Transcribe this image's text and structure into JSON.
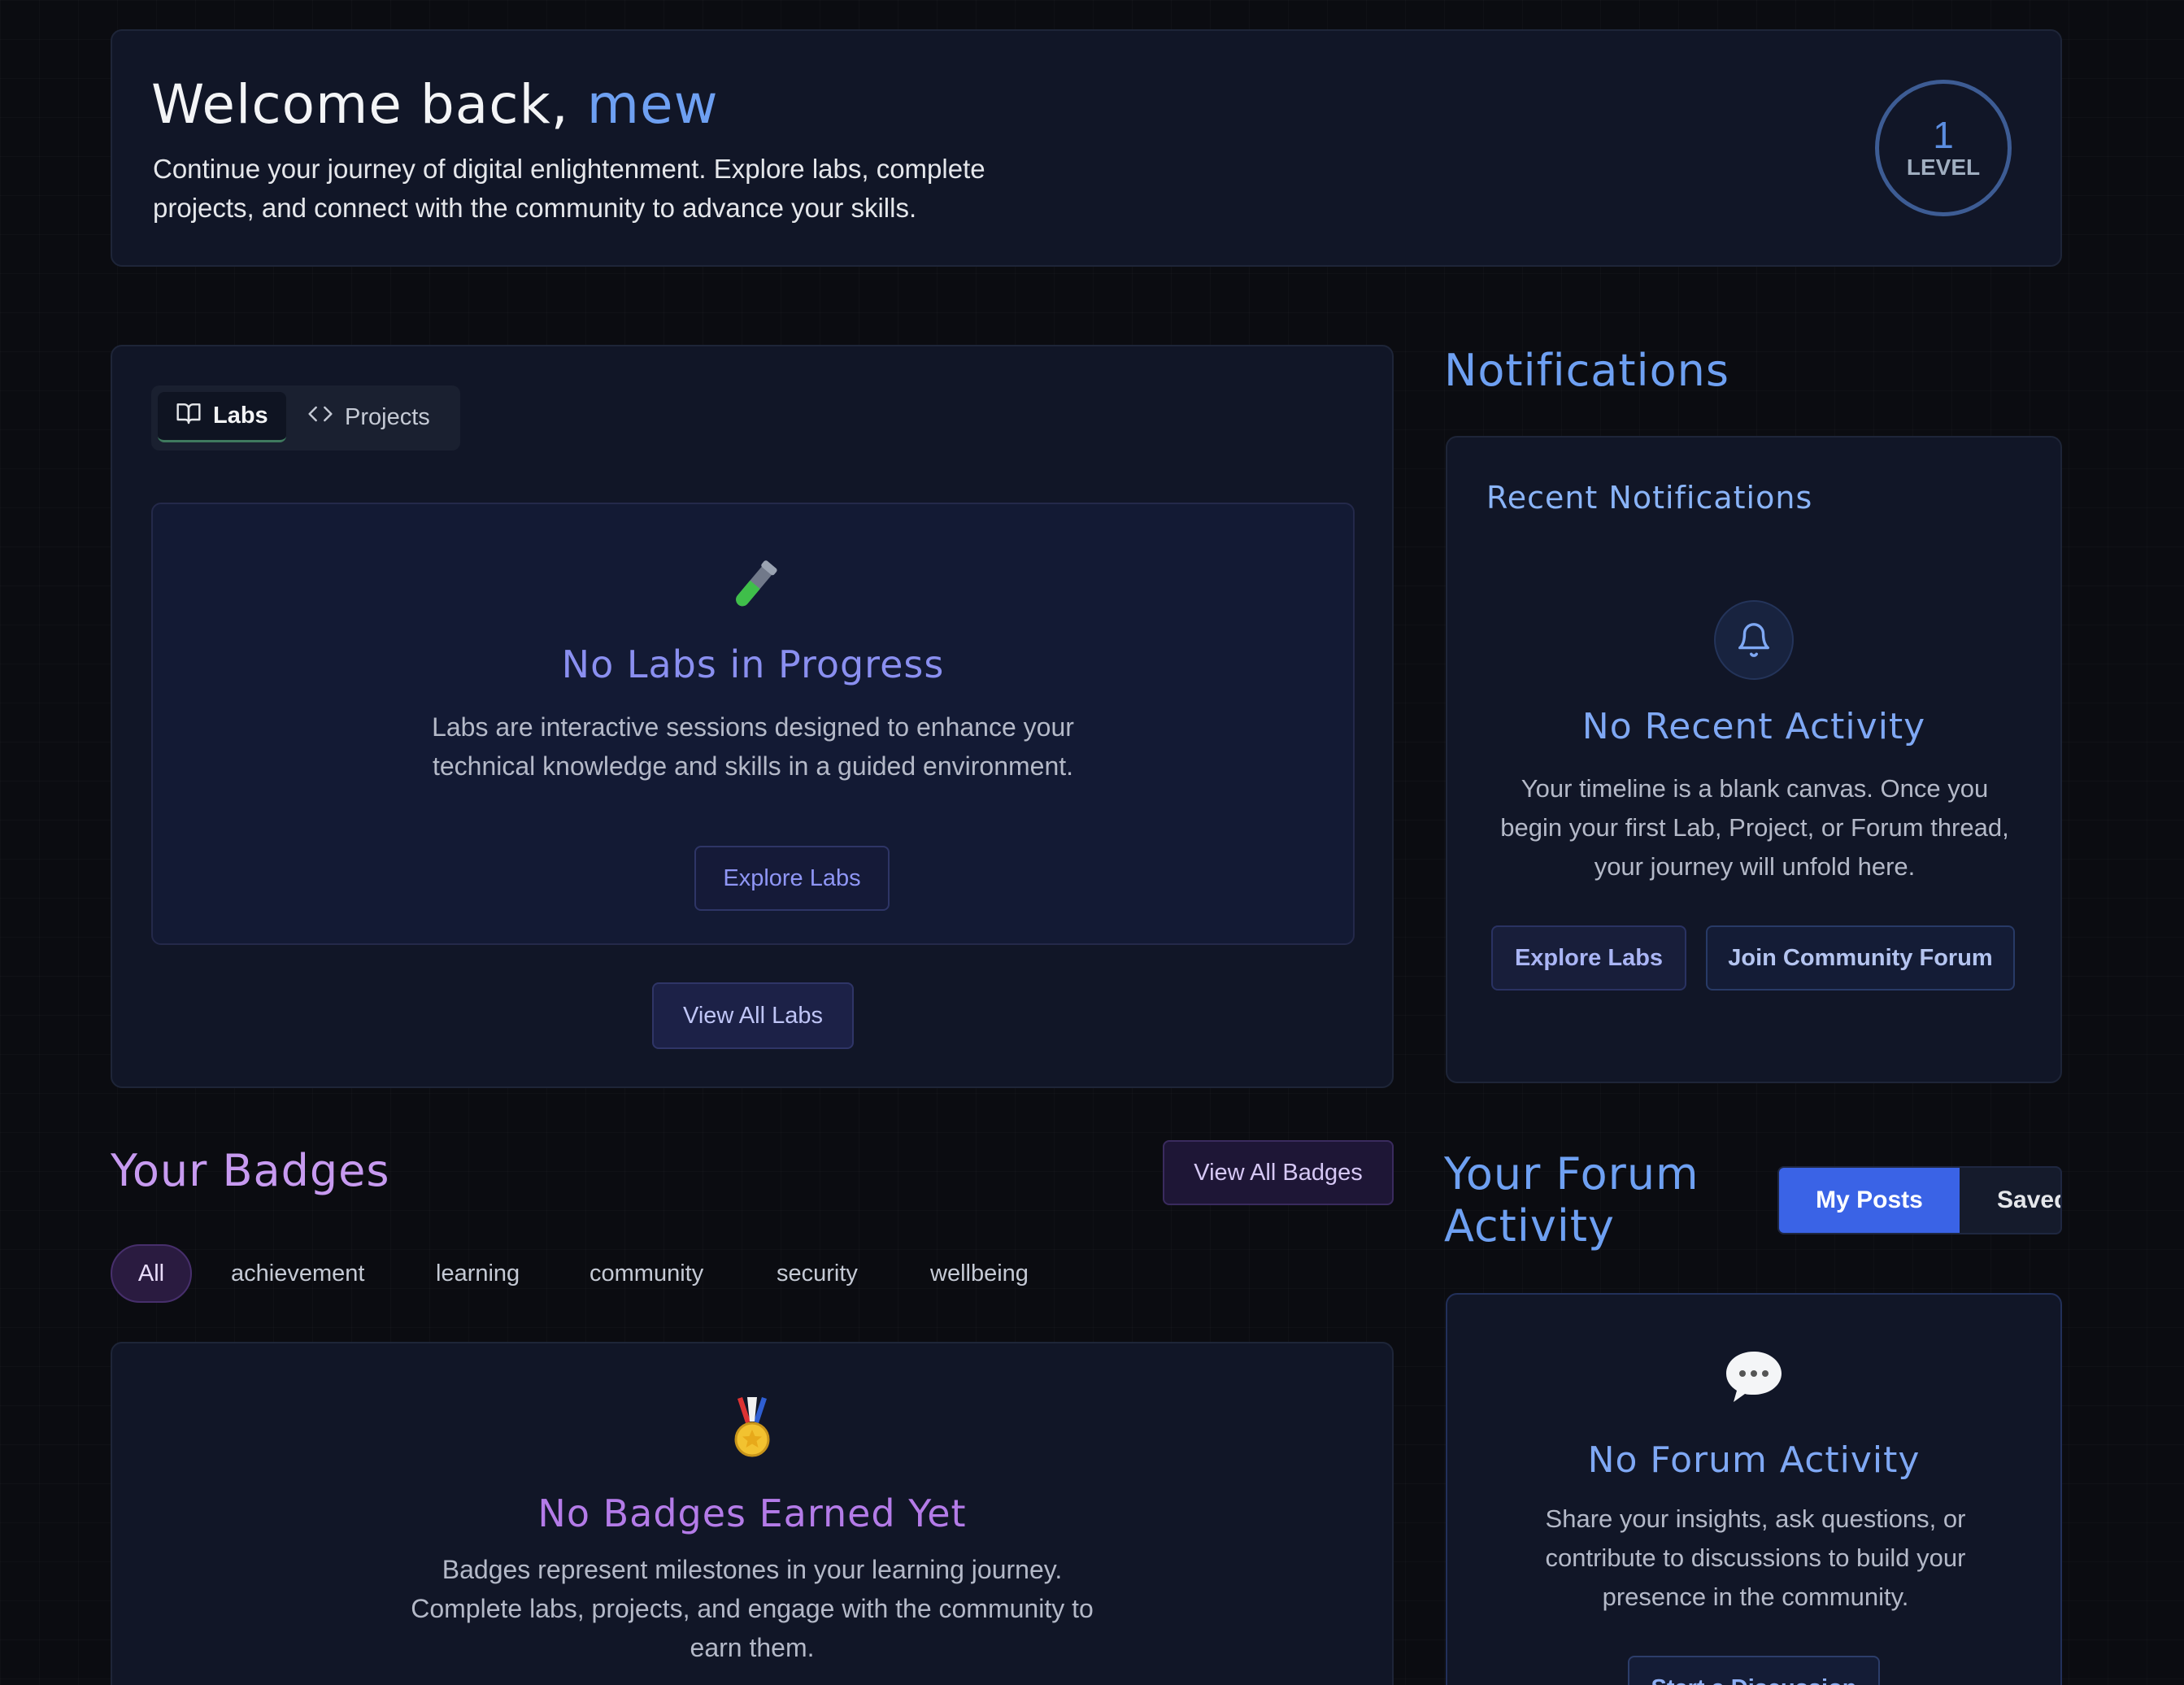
{
  "welcome": {
    "greeting": "Welcome back, ",
    "username": "mew",
    "description": "Continue your journey of digital enlightenment. Explore labs, complete projects, and connect with the community to advance your skills.",
    "level_number": "1",
    "level_label": "LEVEL"
  },
  "labs_panel": {
    "tabs": [
      {
        "label": "Labs",
        "icon": "book-open-icon",
        "active": true
      },
      {
        "label": "Projects",
        "icon": "code-icon",
        "active": false
      }
    ],
    "empty_icon": "test-tube-icon",
    "empty_title": "No Labs in Progress",
    "empty_text": "Labs are interactive sessions designed to enhance your technical knowledge and skills in a guided environment.",
    "explore_label": "Explore Labs",
    "view_all_label": "View All Labs"
  },
  "notifications": {
    "section_title": "Notifications",
    "card_title": "Recent Notifications",
    "empty_icon": "bell-icon",
    "empty_title": "No Recent Activity",
    "empty_text": "Your timeline is a blank canvas. Once you begin your first Lab, Project, or Forum thread, your journey will unfold here.",
    "explore_label": "Explore Labs",
    "forum_label": "Join Community Forum"
  },
  "badges": {
    "section_title": "Your Badges",
    "view_all_label": "View All Badges",
    "filters": [
      "All",
      "achievement",
      "learning",
      "community",
      "security",
      "wellbeing"
    ],
    "active_filter": "All",
    "empty_icon": "medal-icon",
    "empty_title": "No Badges Earned Yet",
    "empty_text": "Badges represent milestones in your learning journey. Complete labs, projects, and engage with the community to earn them."
  },
  "forum": {
    "section_title": "Your Forum Activity",
    "toggle": [
      "My Posts",
      "Saved"
    ],
    "active_toggle": "My Posts",
    "empty_icon": "speech-bubble-icon",
    "empty_title": "No Forum Activity",
    "empty_text": "Share your insights, ask questions, or contribute to discussions to build your presence in the community.",
    "start_label": "Start a Discussion"
  },
  "colors": {
    "accent_blue": "#6ea0f2",
    "accent_purple": "#b47be8",
    "primary_button": "#3a63e6",
    "card_bg": "#111627"
  }
}
